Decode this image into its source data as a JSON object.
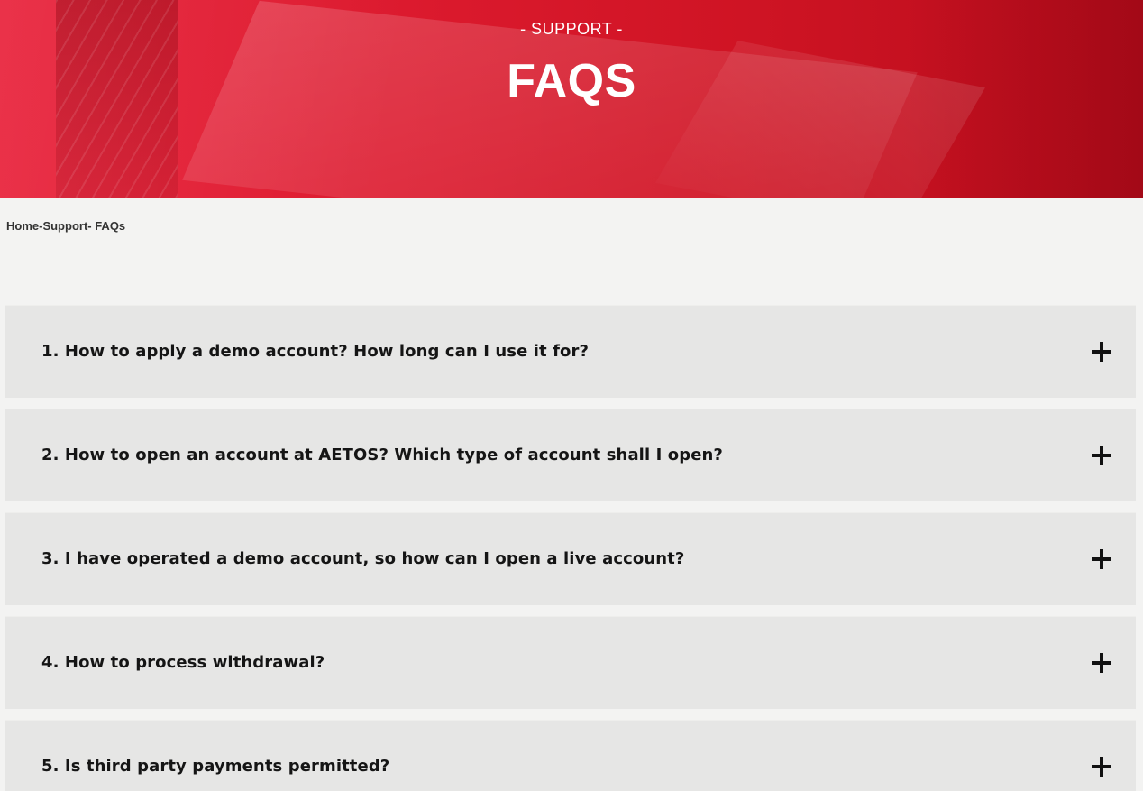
{
  "hero": {
    "kicker": "- SUPPORT -",
    "title": "FAQS",
    "accent_color": "#d91a2d"
  },
  "breadcrumb": "Home-Support- FAQs",
  "faqs": [
    {
      "question": "1. How to apply a demo account? How long can I use it for?",
      "icon": "plus-icon"
    },
    {
      "question": "2. How to open an account at AETOS? Which type of account shall I open?",
      "icon": "plus-icon"
    },
    {
      "question": "3. I have operated a demo account, so how can I open a live account?",
      "icon": "plus-icon"
    },
    {
      "question": "4. How to process withdrawal?",
      "icon": "plus-icon"
    },
    {
      "question": "5. Is third party payments permitted?",
      "icon": "plus-icon"
    }
  ]
}
